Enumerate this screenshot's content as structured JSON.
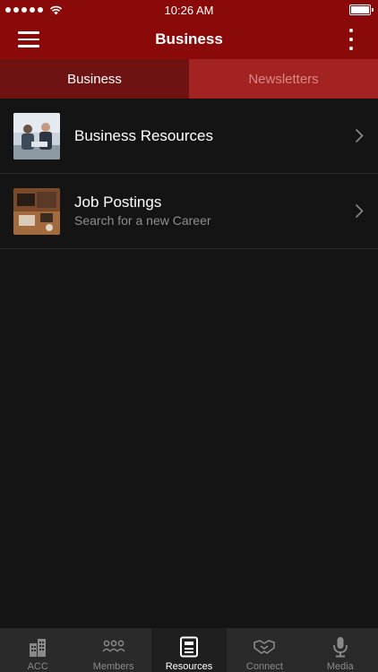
{
  "status_bar": {
    "time": "10:26 AM"
  },
  "nav": {
    "title": "Business",
    "menu_icon": "hamburger-menu-icon",
    "more_icon": "vertical-ellipsis-icon"
  },
  "segment_tabs": [
    {
      "label": "Business",
      "active": true
    },
    {
      "label": "Newsletters",
      "active": false
    }
  ],
  "list_items": [
    {
      "title": "Business Resources",
      "subtitle": ""
    },
    {
      "title": "Job Postings",
      "subtitle": "Search for a new Career"
    }
  ],
  "bottom_tabs": [
    {
      "label": "ACC",
      "icon": "building-icon",
      "active": false
    },
    {
      "label": "Members",
      "icon": "people-group-icon",
      "active": false
    },
    {
      "label": "Resources",
      "icon": "document-icon",
      "active": true
    },
    {
      "label": "Connect",
      "icon": "handshake-icon",
      "active": false
    },
    {
      "label": "Media",
      "icon": "microphone-icon",
      "active": false
    }
  ],
  "colors": {
    "brand_red": "#8a0a0a",
    "tab_active_bg": "#6e1212",
    "tab_inactive_bg": "#a32323",
    "background": "#141414",
    "tabbar_bg": "#2a2a2a"
  }
}
